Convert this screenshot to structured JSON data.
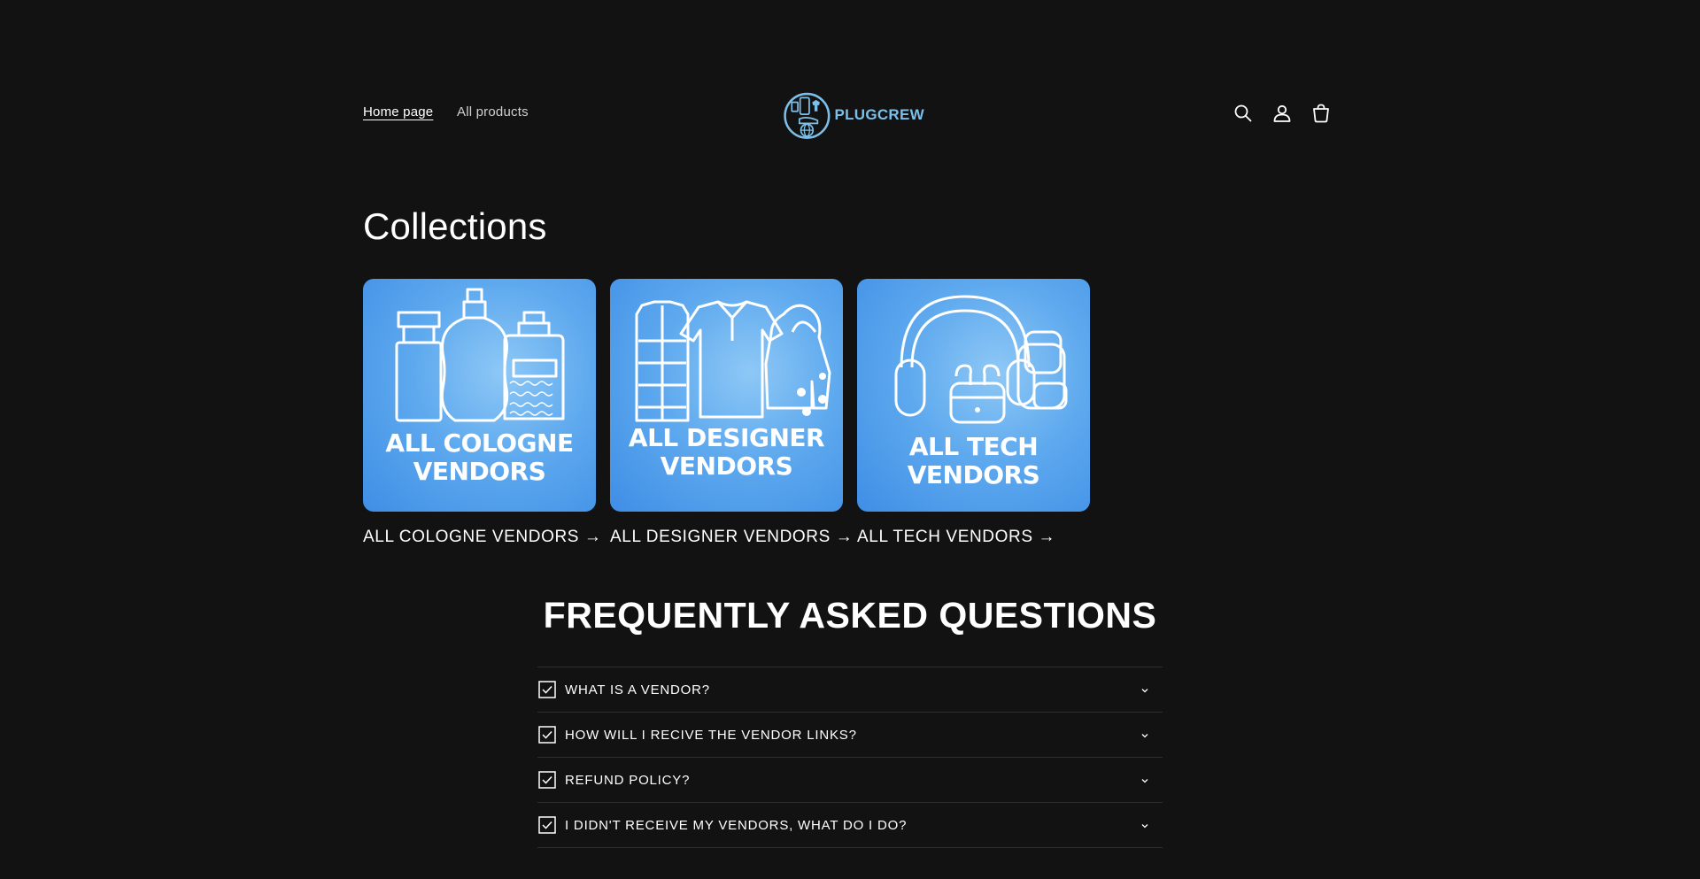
{
  "header": {
    "nav": [
      {
        "label": "Home page"
      },
      {
        "label": "All products"
      }
    ],
    "logo_text": "PLUGCREW",
    "icons": [
      "search-icon",
      "account-icon",
      "cart-icon"
    ]
  },
  "collections": {
    "title": "Collections",
    "items": [
      {
        "image_line1": "ALL COLOGNE",
        "image_line2": "VENDORS",
        "label": "ALL COLOGNE VENDORS →",
        "icon": "cologne-bottles-icon"
      },
      {
        "image_line1": "ALL DESIGNER",
        "image_line2": "VENDORS",
        "label": "ALL DESIGNER VENDORS →",
        "icon": "clothing-icon"
      },
      {
        "image_line1": "ALL TECH",
        "image_line2": "VENDORS",
        "label": "ALL TECH VENDORS →",
        "icon": "headphones-icon"
      }
    ]
  },
  "faq": {
    "title": "FREQUENTLY ASKED QUESTIONS",
    "items": [
      {
        "question": "WHAT IS A VENDOR?"
      },
      {
        "question": "HOW WILL I RECIVE THE VENDOR LINKS?"
      },
      {
        "question": "REFUND POLICY?"
      },
      {
        "question": "I DIDN'T RECEIVE MY VENDORS, WHAT DO I DO?"
      }
    ]
  },
  "colors": {
    "background": "#121212",
    "accent": "#7cc0ea",
    "card_blue": "#5ea9ee"
  }
}
